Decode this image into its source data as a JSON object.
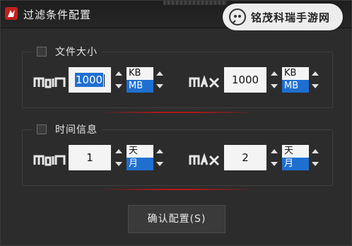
{
  "window": {
    "title": "过滤条件配置"
  },
  "watermark": {
    "text": "铭茂科瑞手游网"
  },
  "file_size": {
    "title": "文件大小",
    "checked": false,
    "min_label": "MIN",
    "max_label": "MAX",
    "min": {
      "value": "1000",
      "units": [
        "KB",
        "MB"
      ],
      "selected_unit": "MB"
    },
    "max": {
      "value": "1000",
      "units": [
        "KB",
        "MB"
      ],
      "selected_unit": "MB"
    }
  },
  "time_info": {
    "title": "时间信息",
    "checked": false,
    "min_label": "MIN",
    "max_label": "MAX",
    "min": {
      "value": "1",
      "units": [
        "天",
        "月"
      ],
      "selected_unit": "月"
    },
    "max": {
      "value": "2",
      "units": [
        "天",
        "月"
      ],
      "selected_unit": "月"
    }
  },
  "confirm_button": "确认配置(S)",
  "colors": {
    "accent_red": "#b01818",
    "selection_blue": "#1e6fd0"
  }
}
